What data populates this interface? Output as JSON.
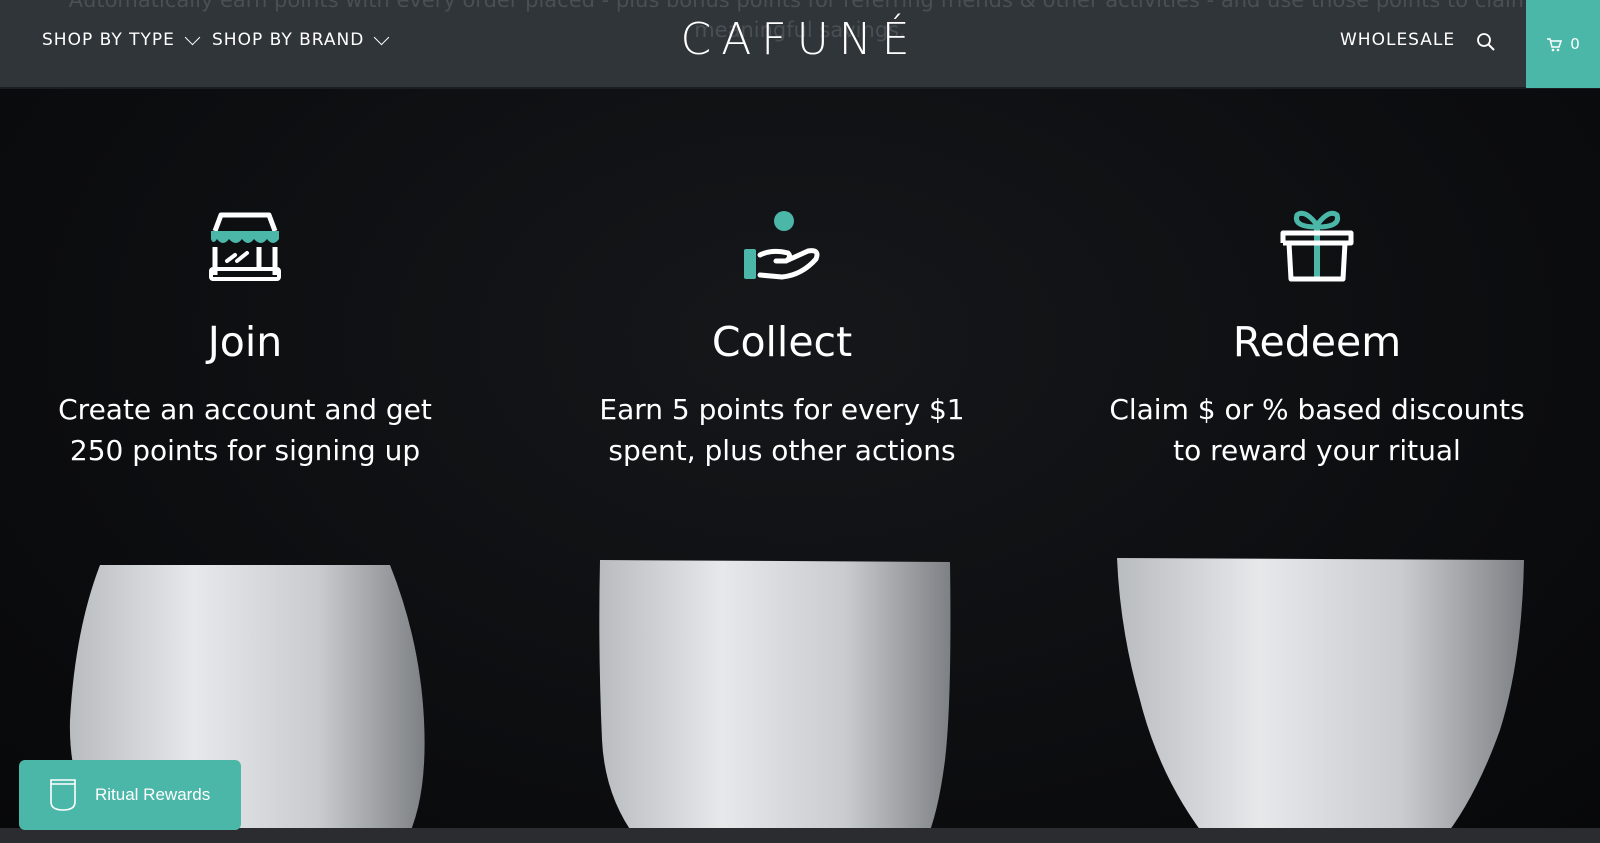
{
  "header": {
    "background_text_line1": "Automatically earn points with every order placed - plus bonus points for referring friends & other activities - and use those points to claim",
    "background_text_line2": "meaningful savings.",
    "nav": [
      {
        "label": "SHOP BY TYPE",
        "icon": "chevron-down-icon"
      },
      {
        "label": "SHOP BY BRAND",
        "icon": "chevron-down-icon"
      }
    ],
    "logo": "CAFUNÉ",
    "wholesale_label": "WHOLESALE",
    "search_icon": "search-icon",
    "cart_count": "0",
    "accent_color": "#4bb7a8"
  },
  "steps": [
    {
      "icon": "storefront-icon",
      "title": "Join",
      "line1": "Create an account and get",
      "line2": "250 points for signing up"
    },
    {
      "icon": "hand-coin-icon",
      "title": "Collect",
      "line1": "Earn 5 points for every $1",
      "line2": "spent, plus other actions"
    },
    {
      "icon": "gift-icon",
      "title": "Redeem",
      "line1": "Claim $ or % based discounts",
      "line2": "to reward your ritual"
    }
  ],
  "rewards_button": {
    "label": "Ritual Rewards",
    "icon": "cup-icon"
  }
}
